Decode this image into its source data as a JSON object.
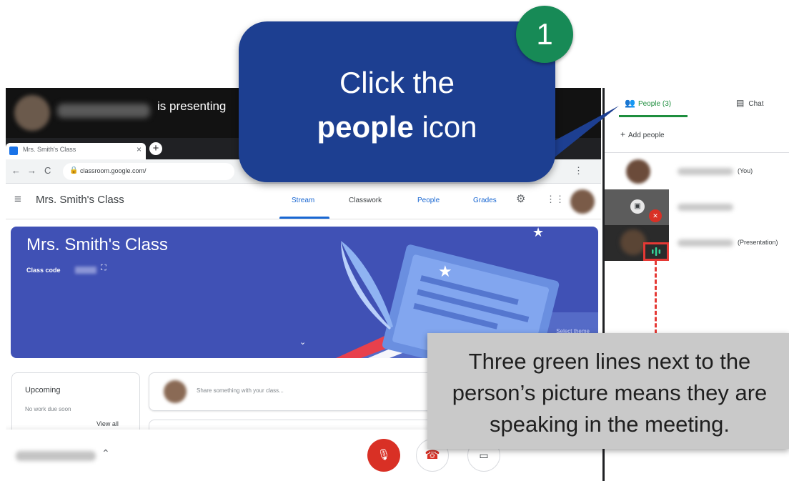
{
  "presenting": {
    "suffix": "is presenting"
  },
  "browser": {
    "tab_title": "Mrs. Smith's Class",
    "tab_close": "×",
    "new_tab": "+",
    "back": "←",
    "forward": "→",
    "reload": "C",
    "lock": "🔒",
    "url": "classroom.google.com/",
    "menu": "⋮"
  },
  "classroom": {
    "menu_icon": "≡",
    "title": "Mrs. Smith's Class",
    "tabs": [
      "Stream",
      "Classwork",
      "People",
      "Grades"
    ],
    "settings_icon": "⚙",
    "apps_icon": "⋮⋮",
    "banner_title": "Mrs. Smith's Class",
    "class_code_label": "Class code",
    "fullscreen_icon": "⛶",
    "select_theme": "Select theme",
    "expand_icon": "⌄",
    "upcoming_title": "Upcoming",
    "upcoming_empty": "No work due soon",
    "view_all": "View all",
    "share_placeholder": "Share something with your class..."
  },
  "controls": {
    "caret": "⌃",
    "mic_icon": "🎙",
    "leave_icon": "☎",
    "camera_icon": "▭"
  },
  "panel": {
    "people_icon": "👥",
    "people_tab": "People (3)",
    "chat_icon": "▤",
    "chat_tab": "Chat",
    "add_people_icon": "+",
    "add_people": "Add people",
    "participants": [
      {
        "suffix": "(You)"
      },
      {
        "suffix": "",
        "presenting_icon": "▣",
        "muted_icon": "✕"
      },
      {
        "suffix": "(Presentation)"
      }
    ]
  },
  "callout": {
    "line1": "Click the",
    "line2_strong": "people",
    "line2_rest": " icon",
    "step": "1"
  },
  "speaking_callout": {
    "text": "Three green lines next to the person’s picture means they are speaking in the meeting."
  },
  "colors": {
    "callout_blue": "#1d3f91",
    "step_green": "#178a56",
    "speaking_green": "#1e8e3e",
    "highlight_red": "#e53935",
    "mic_red": "#d93025",
    "banner_blue": "#4051b5"
  }
}
